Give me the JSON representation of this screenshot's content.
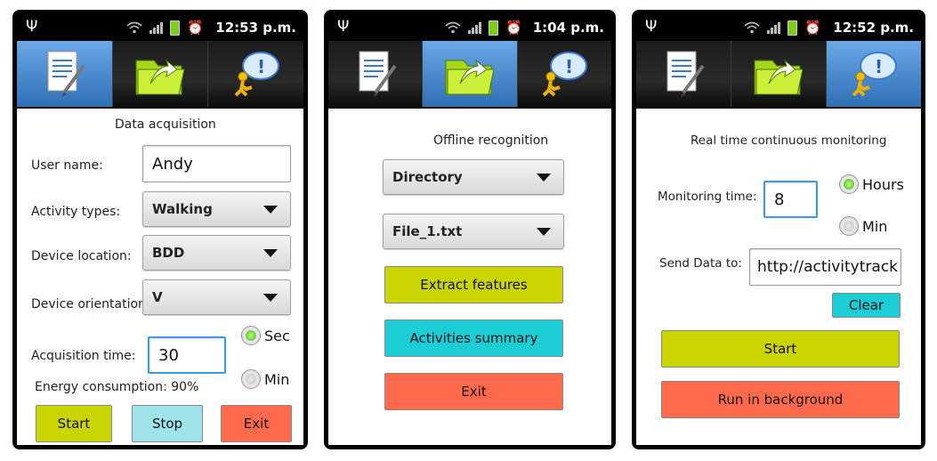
{
  "colors": {
    "tab_selected": "#3f83cf",
    "yellow_button": "#c9d400",
    "cyan_button": "#1ccdd6",
    "light_cyan_button": "#9fe3ea",
    "red_button": "#ff6a4d",
    "focus_border": "#3a9be0",
    "radio_on": "#49b31a"
  },
  "icons": [
    "document-pen-icon",
    "folder-arrow-icon",
    "person-speech-icon"
  ],
  "screen1": {
    "status_time": "12:53 p.m.",
    "title": "Data acquisition",
    "user_name_label": "User name:",
    "user_name_value": "Andy",
    "activity_types_label": "Activity types:",
    "activity_types_value": "Walking",
    "device_location_label": "Device location:",
    "device_location_value": "BDD",
    "device_orientation_label": "Device orientation:",
    "device_orientation_value": "V",
    "acquisition_time_label": "Acquisition time:",
    "acquisition_time_value": "30",
    "unit_sec": "Sec",
    "unit_min": "Min",
    "energy": "Energy consumption: 90%",
    "start": "Start",
    "stop": "Stop",
    "exit": "Exit"
  },
  "screen2": {
    "status_time": "1:04 p.m.",
    "title": "Offline recognition",
    "directory_value": "Directory",
    "file_value": "File_1.txt",
    "extract": "Extract features",
    "summary": "Activities summary",
    "exit": "Exit"
  },
  "screen3": {
    "status_time": "12:52 p.m.",
    "title": "Real time continuous monitoring",
    "monitoring_label": "Monitoring time:",
    "monitoring_value": "8",
    "unit_hours": "Hours",
    "unit_min": "Min",
    "send_label": "Send Data to:",
    "send_value": "http://activitytrack",
    "clear": "Clear",
    "start": "Start",
    "background": "Run in background"
  }
}
